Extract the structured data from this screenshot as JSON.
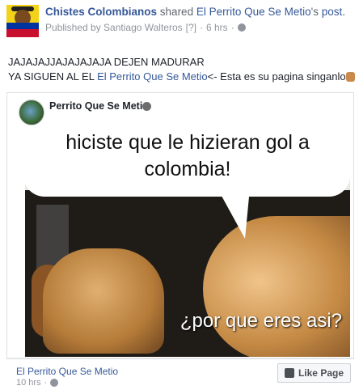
{
  "header": {
    "page_name": "Chistes Colombianos",
    "shared_text": "shared",
    "original_page": "El Perrito Que Se Metio",
    "possessive_suffix": "'s",
    "post_word": "post.",
    "published_by": "Published by Santiago Walteros",
    "info_marker": "[?]",
    "time": "6 hrs"
  },
  "post": {
    "line1": "JAJAJAJJAJAJAJAJA DEJEN MADURAR",
    "line2_prefix": "YA SIGUEN AL EL ",
    "line2_link": "El Perrito Que Se Metio",
    "line2_suffix": "<- Esta es su pagina singanlo"
  },
  "shared_card": {
    "page_title": "Perrito Que Se Meti",
    "meme_top_line1": "hiciste que le hizieran gol a",
    "meme_top_line2": "colombia!",
    "meme_bottom": "¿por que eres asi?"
  },
  "footer": {
    "page_name": "El Perrito Que Se Metio",
    "time": "10 hrs",
    "like_button": "Like Page"
  },
  "icons": {
    "globe": "globe-icon",
    "thumbs_up": "thumbs-up-icon"
  },
  "colors": {
    "link": "#365899",
    "meta": "#90949c"
  }
}
